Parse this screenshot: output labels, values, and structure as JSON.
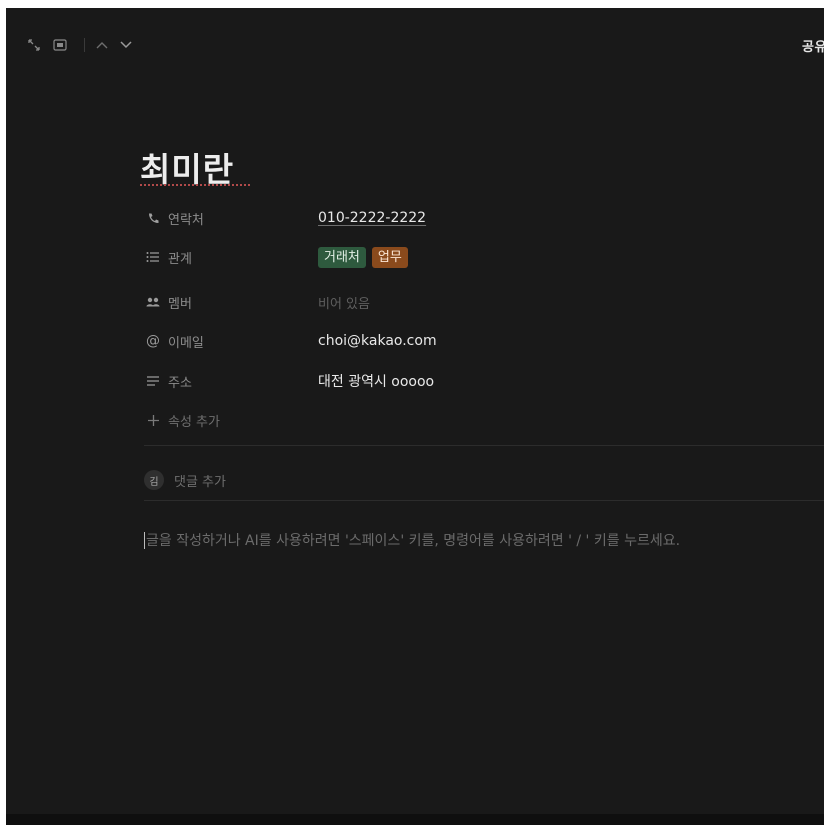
{
  "topbar": {
    "icons": [
      "expand-icon",
      "peek-mode-icon",
      "chevron-up-icon",
      "chevron-down-icon"
    ],
    "share_label": "공유"
  },
  "page": {
    "title": "최미란"
  },
  "properties": [
    {
      "icon": "phone-icon",
      "label": "연락처",
      "value": "010-2222-2222"
    },
    {
      "icon": "list-icon",
      "label": "관계",
      "tags": [
        "거래처",
        "업무"
      ]
    },
    {
      "icon": "people-icon",
      "label": "멤버",
      "value": "비어 있음"
    },
    {
      "icon": "at-icon",
      "label": "이메일",
      "value": "choi@kakao.com"
    },
    {
      "icon": "text-lines-icon",
      "label": "주소",
      "value": "대전 광역시 ooooo"
    }
  ],
  "add_property_label": "속성 추가",
  "comment": {
    "avatar_initial": "김",
    "label": "댓글 추가"
  },
  "editor": {
    "placeholder": "글을 작성하거나 AI를 사용하려면 '스페이스' 키를, 명령어를 사용하려면 ' / ' 키를 누르세요."
  },
  "colors": {
    "background": "#191919",
    "tag_green": "#2e5a3e",
    "tag_orange": "#8a4a1c"
  }
}
